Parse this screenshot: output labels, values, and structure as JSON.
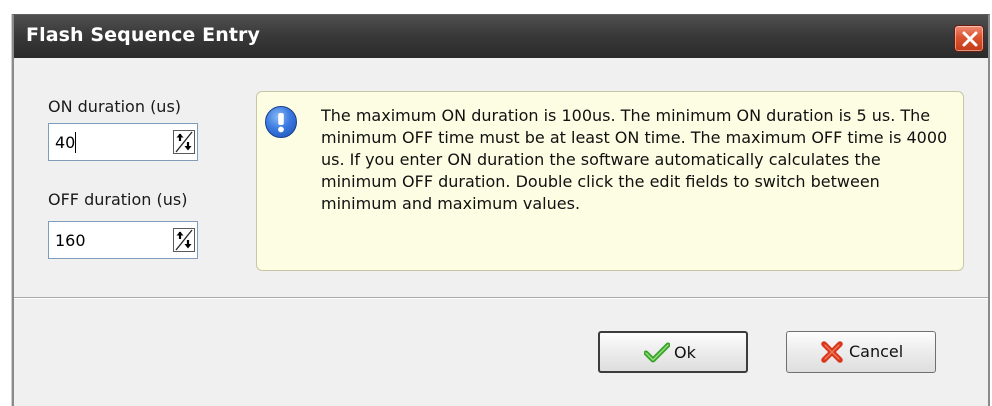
{
  "window": {
    "title": "Flash Sequence Entry"
  },
  "on_duration": {
    "label": "ON duration (us)",
    "value": "40"
  },
  "off_duration": {
    "label": "OFF duration (us)",
    "value": "160"
  },
  "info": {
    "icon": "exclamation-icon",
    "text": "The maximum ON duration is 100us. The minimum ON duration is 5 us. The minimum OFF time must be at least ON time. The maximum OFF time is 4000 us. If you enter ON duration the software automatically calculates the minimum OFF duration. Double click the edit fields to switch between minimum and maximum values."
  },
  "buttons": {
    "ok_label": "Ok",
    "cancel_label": "Cancel"
  },
  "colors": {
    "titlebar": "#3a3a3a",
    "close": "#d9542f",
    "info_bg": "#fcfde3",
    "info_icon": "#3b7be0",
    "ok_check": "#3aa12b",
    "cancel_x": "#d9361b"
  }
}
